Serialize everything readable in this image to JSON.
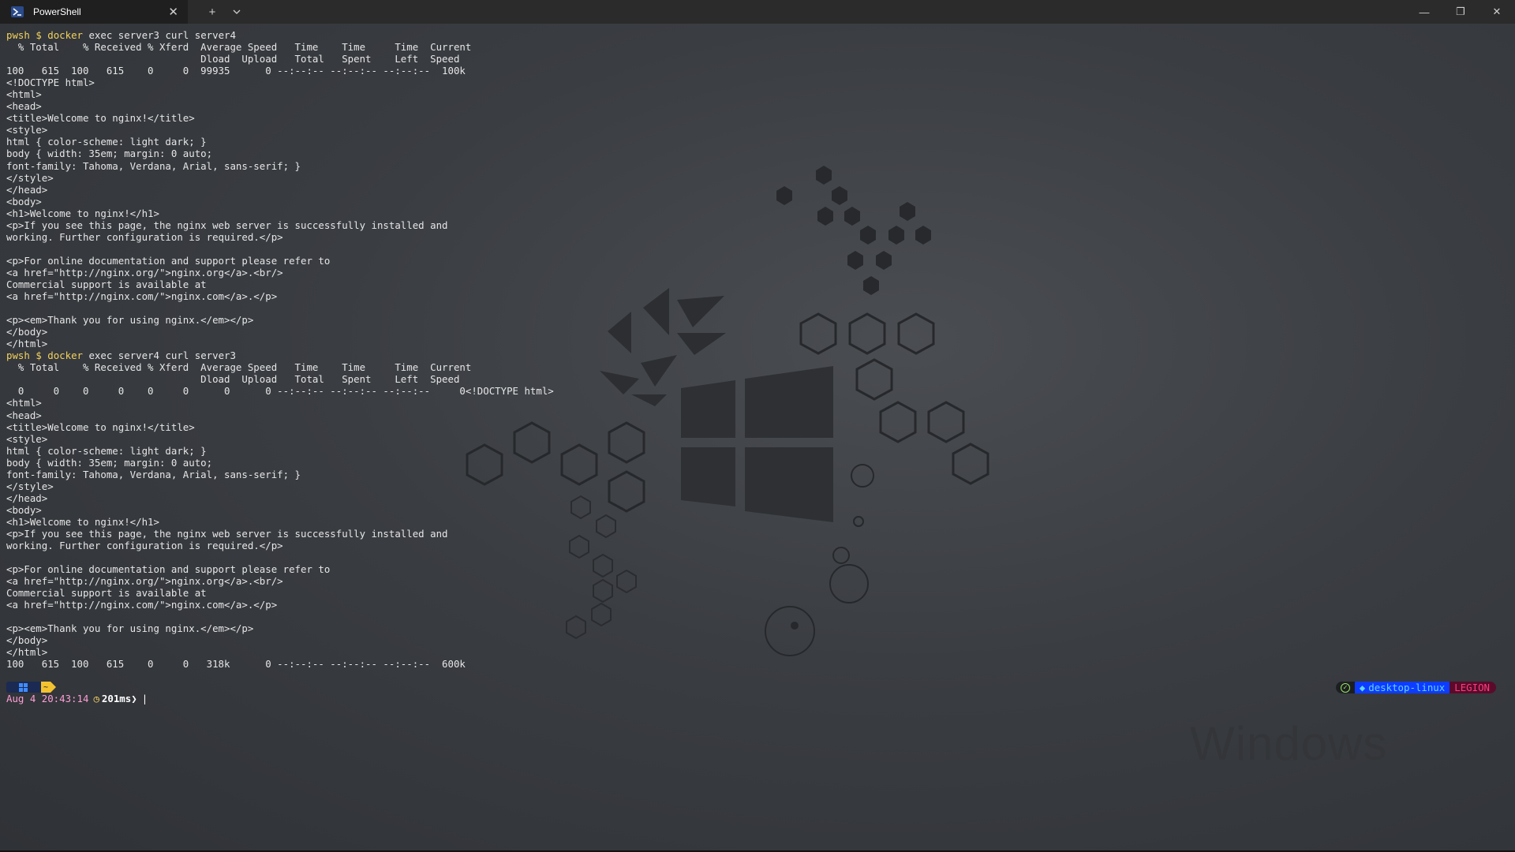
{
  "window": {
    "tab_title": "PowerShell",
    "tab_icon": "powershell-icon",
    "close_tab_glyph": "✕",
    "new_tab_glyph": "+",
    "dropdown_glyph": "⌄",
    "minimize_glyph": "—",
    "maximize_glyph": "❐",
    "close_glyph": "✕"
  },
  "wallpaper": {
    "wordmark": "Windows"
  },
  "terminal": {
    "lines": [
      {
        "type": "prompt",
        "word": "pwsh",
        "dollar": "$",
        "cmd": "docker",
        "rest": " exec server3 curl server4"
      },
      {
        "type": "text",
        "text": "  % Total    % Received % Xferd  Average Speed   Time    Time     Time  Current"
      },
      {
        "type": "text",
        "text": "                                 Dload  Upload   Total   Spent    Left  Speed"
      },
      {
        "type": "text",
        "text": "100   615  100   615    0     0  99935      0 --:--:-- --:--:-- --:--:--  100k"
      },
      {
        "type": "text",
        "text": "<!DOCTYPE html>"
      },
      {
        "type": "text",
        "text": "<html>"
      },
      {
        "type": "text",
        "text": "<head>"
      },
      {
        "type": "text",
        "text": "<title>Welcome to nginx!</title>"
      },
      {
        "type": "text",
        "text": "<style>"
      },
      {
        "type": "text",
        "text": "html { color-scheme: light dark; }"
      },
      {
        "type": "text",
        "text": "body { width: 35em; margin: 0 auto;"
      },
      {
        "type": "text",
        "text": "font-family: Tahoma, Verdana, Arial, sans-serif; }"
      },
      {
        "type": "text",
        "text": "</style>"
      },
      {
        "type": "text",
        "text": "</head>"
      },
      {
        "type": "text",
        "text": "<body>"
      },
      {
        "type": "text",
        "text": "<h1>Welcome to nginx!</h1>"
      },
      {
        "type": "text",
        "text": "<p>If you see this page, the nginx web server is successfully installed and"
      },
      {
        "type": "text",
        "text": "working. Further configuration is required.</p>"
      },
      {
        "type": "text",
        "text": ""
      },
      {
        "type": "text",
        "text": "<p>For online documentation and support please refer to"
      },
      {
        "type": "text",
        "text": "<a href=\"http://nginx.org/\">nginx.org</a>.<br/>"
      },
      {
        "type": "text",
        "text": "Commercial support is available at"
      },
      {
        "type": "text",
        "text": "<a href=\"http://nginx.com/\">nginx.com</a>.</p>"
      },
      {
        "type": "text",
        "text": ""
      },
      {
        "type": "text",
        "text": "<p><em>Thank you for using nginx.</em></p>"
      },
      {
        "type": "text",
        "text": "</body>"
      },
      {
        "type": "text",
        "text": "</html>"
      },
      {
        "type": "prompt",
        "word": "pwsh",
        "dollar": "$",
        "cmd": "docker",
        "rest": " exec server4 curl server3"
      },
      {
        "type": "text",
        "text": "  % Total    % Received % Xferd  Average Speed   Time    Time     Time  Current"
      },
      {
        "type": "text",
        "text": "                                 Dload  Upload   Total   Spent    Left  Speed"
      },
      {
        "type": "text",
        "text": "  0     0    0     0    0     0      0      0 --:--:-- --:--:-- --:--:--     0<!DOCTYPE html>"
      },
      {
        "type": "text",
        "text": "<html>"
      },
      {
        "type": "text",
        "text": "<head>"
      },
      {
        "type": "text",
        "text": "<title>Welcome to nginx!</title>"
      },
      {
        "type": "text",
        "text": "<style>"
      },
      {
        "type": "text",
        "text": "html { color-scheme: light dark; }"
      },
      {
        "type": "text",
        "text": "body { width: 35em; margin: 0 auto;"
      },
      {
        "type": "text",
        "text": "font-family: Tahoma, Verdana, Arial, sans-serif; }"
      },
      {
        "type": "text",
        "text": "</style>"
      },
      {
        "type": "text",
        "text": "</head>"
      },
      {
        "type": "text",
        "text": "<body>"
      },
      {
        "type": "text",
        "text": "<h1>Welcome to nginx!</h1>"
      },
      {
        "type": "text",
        "text": "<p>If you see this page, the nginx web server is successfully installed and"
      },
      {
        "type": "text",
        "text": "working. Further configuration is required.</p>"
      },
      {
        "type": "text",
        "text": ""
      },
      {
        "type": "text",
        "text": "<p>For online documentation and support please refer to"
      },
      {
        "type": "text",
        "text": "<a href=\"http://nginx.org/\">nginx.org</a>.<br/>"
      },
      {
        "type": "text",
        "text": "Commercial support is available at"
      },
      {
        "type": "text",
        "text": "<a href=\"http://nginx.com/\">nginx.com</a>.</p>"
      },
      {
        "type": "text",
        "text": ""
      },
      {
        "type": "text",
        "text": "<p><em>Thank you for using nginx.</em></p>"
      },
      {
        "type": "text",
        "text": "</body>"
      },
      {
        "type": "text",
        "text": "</html>"
      },
      {
        "type": "text",
        "text": "100   615  100   615    0     0   318k      0 --:--:-- --:--:-- --:--:--  600k"
      }
    ]
  },
  "prompt": {
    "home_glyph": "~",
    "os_icon": "windows-icon",
    "datetime": "Aug 4 20:43:14",
    "duration_icon": "stopwatch-icon",
    "duration": "201ms",
    "chevron": "❯",
    "cursor": "|"
  },
  "right_prompt": {
    "status_icon": "check-circle-icon",
    "context_icon": "docker-icon",
    "context": "desktop-linux",
    "host": "LEGION"
  },
  "colors": {
    "prompt_yellow": "#f4d35e",
    "datetime_pink": "#ff9fd6",
    "context_blue": "#0d3cff",
    "host_pink": "#ff3c7a"
  }
}
